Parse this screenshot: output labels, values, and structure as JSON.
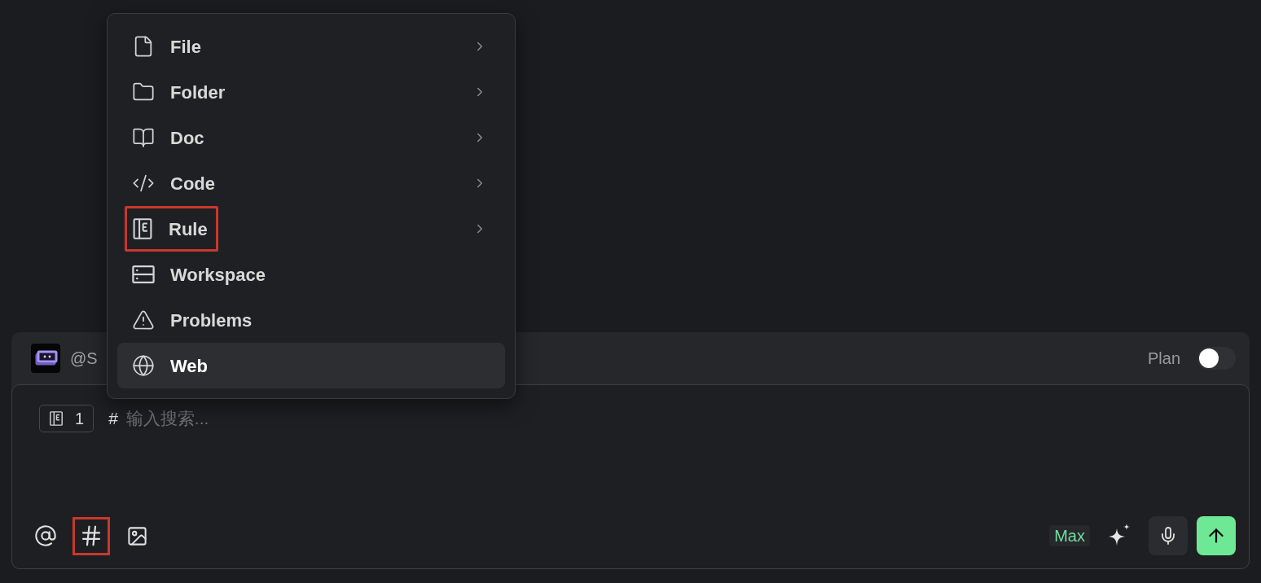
{
  "menu": {
    "items": [
      {
        "kind": "file",
        "label": "File",
        "submenu": true,
        "selected": false,
        "marked": false
      },
      {
        "kind": "folder",
        "label": "Folder",
        "submenu": true,
        "selected": false,
        "marked": false
      },
      {
        "kind": "doc",
        "label": "Doc",
        "submenu": true,
        "selected": false,
        "marked": false
      },
      {
        "kind": "code",
        "label": "Code",
        "submenu": true,
        "selected": false,
        "marked": false
      },
      {
        "kind": "rule",
        "label": "Rule",
        "submenu": true,
        "selected": false,
        "marked": true
      },
      {
        "kind": "workspace",
        "label": "Workspace",
        "submenu": false,
        "selected": false,
        "marked": false
      },
      {
        "kind": "problems",
        "label": "Problems",
        "submenu": false,
        "selected": false,
        "marked": false
      },
      {
        "kind": "web",
        "label": "Web",
        "submenu": false,
        "selected": true,
        "marked": false
      }
    ]
  },
  "composer": {
    "header": {
      "agent": "@S",
      "plan": {
        "label": "Plan",
        "on": false
      }
    },
    "input": {
      "chips": [
        {
          "kind": "rule",
          "count": "1"
        }
      ],
      "prefix": "#",
      "placeholder": "输入搜索..."
    },
    "toolbar": {
      "left": [
        {
          "kind": "mention",
          "marked": false
        },
        {
          "kind": "context",
          "marked": true
        },
        {
          "kind": "image",
          "marked": false
        }
      ],
      "mode": "Max",
      "right": [
        {
          "kind": "enhance"
        },
        {
          "kind": "voice"
        },
        {
          "kind": "send"
        }
      ]
    }
  }
}
